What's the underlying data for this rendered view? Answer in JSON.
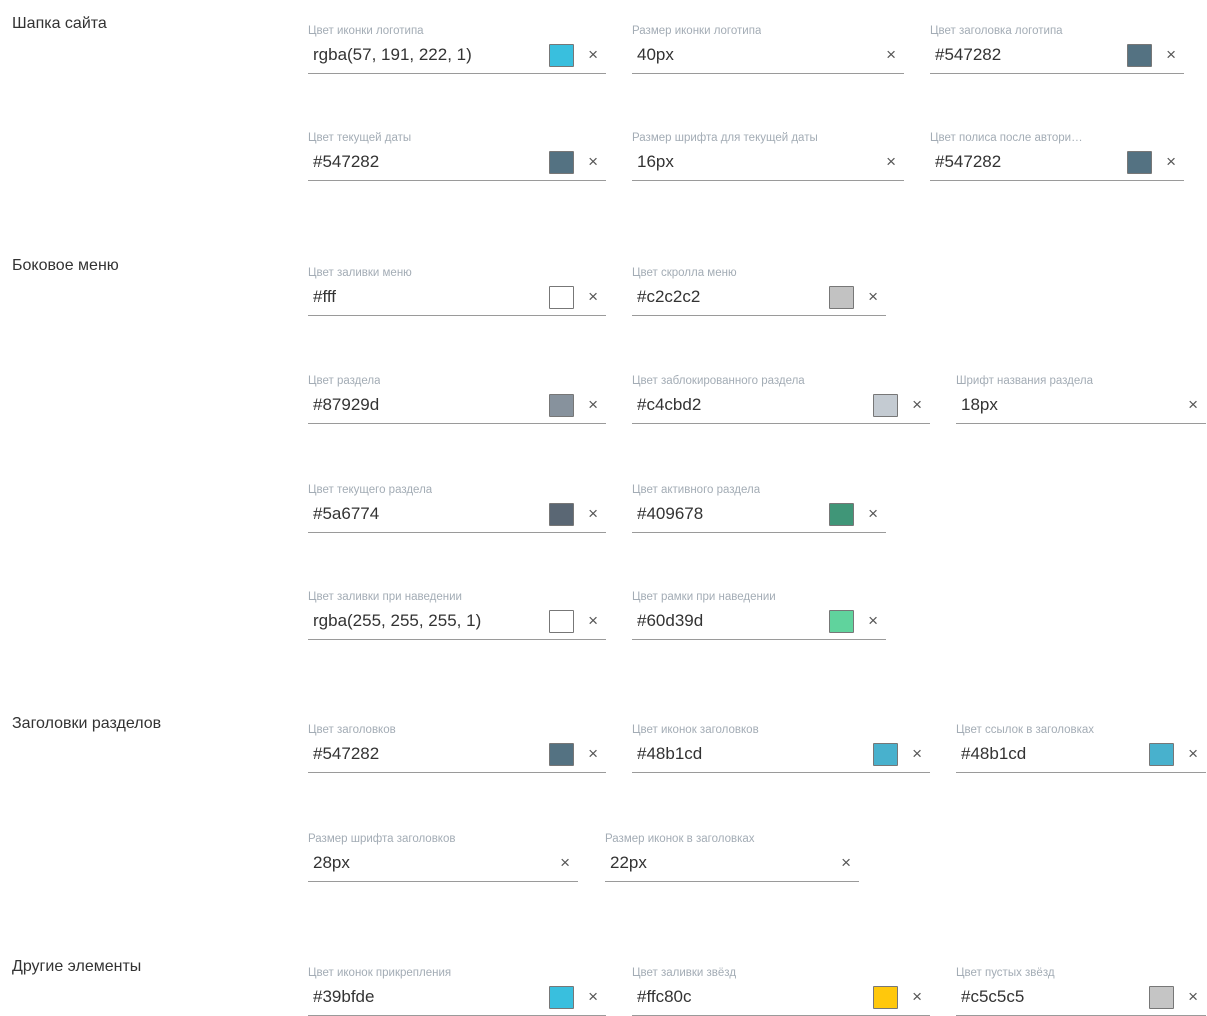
{
  "sections": {
    "header": "Шапка сайта",
    "sidebar": "Боковое меню",
    "headings": "Заголовки разделов",
    "other": "Другие элементы"
  },
  "fields": {
    "logo_icon_color": {
      "label": "Цвет иконки логотипа",
      "value": "rgba(57, 191, 222, 1)",
      "color": "#39bfde"
    },
    "logo_icon_size": {
      "label": "Размер иконки логотипа",
      "value": "40px"
    },
    "logo_title_color": {
      "label": "Цвет заголовка логотипа",
      "value": "#547282",
      "color": "#547282"
    },
    "current_date_color": {
      "label": "Цвет текущей даты",
      "value": "#547282",
      "color": "#547282"
    },
    "current_date_size": {
      "label": "Размер шрифта для текущей даты",
      "value": "16px"
    },
    "policy_color": {
      "label": "Цвет полиса после автори…",
      "value": "#547282",
      "color": "#547282"
    },
    "menu_fill_color": {
      "label": "Цвет заливки меню",
      "value": "#fff",
      "color": "#ffffff"
    },
    "menu_scroll_color": {
      "label": "Цвет скролла меню",
      "value": "#c2c2c2",
      "color": "#c2c2c2"
    },
    "section_color": {
      "label": "Цвет раздела",
      "value": "#87929d",
      "color": "#87929d"
    },
    "locked_section_color": {
      "label": "Цвет заблокированного раздела",
      "value": "#c4cbd2",
      "color": "#c4cbd2"
    },
    "section_font": {
      "label": "Шрифт названия раздела",
      "value": "18px"
    },
    "current_section_color": {
      "label": "Цвет текущего раздела",
      "value": "#5a6774",
      "color": "#5a6774"
    },
    "active_section_color": {
      "label": "Цвет активного раздела",
      "value": "#409678",
      "color": "#409678"
    },
    "hover_fill_color": {
      "label": "Цвет заливки при наведении",
      "value": "rgba(255, 255, 255, 1)",
      "color": "#ffffff"
    },
    "hover_border_color": {
      "label": "Цвет рамки при наведении",
      "value": "#60d39d",
      "color": "#60d39d"
    },
    "headings_color": {
      "label": "Цвет заголовков",
      "value": "#547282",
      "color": "#547282"
    },
    "headings_icons_color": {
      "label": "Цвет иконок заголовков",
      "value": "#48b1cd",
      "color": "#48b1cd"
    },
    "headings_links_color": {
      "label": "Цвет ссылок в заголовках",
      "value": "#48b1cd",
      "color": "#48b1cd"
    },
    "headings_font_size": {
      "label": "Размер шрифта заголовков",
      "value": "28px"
    },
    "headings_icons_size": {
      "label": "Размер иконок в заголовках",
      "value": "22px"
    },
    "pin_icons_color": {
      "label": "Цвет иконок прикрепления",
      "value": "#39bfde",
      "color": "#39bfde"
    },
    "stars_fill_color": {
      "label": "Цвет заливки звёзд",
      "value": "#ffc80c",
      "color": "#ffc80c"
    },
    "stars_empty_color": {
      "label": "Цвет пустых звёзд",
      "value": "#c5c5c5",
      "color": "#c5c5c5"
    }
  },
  "clear_icon": "×"
}
